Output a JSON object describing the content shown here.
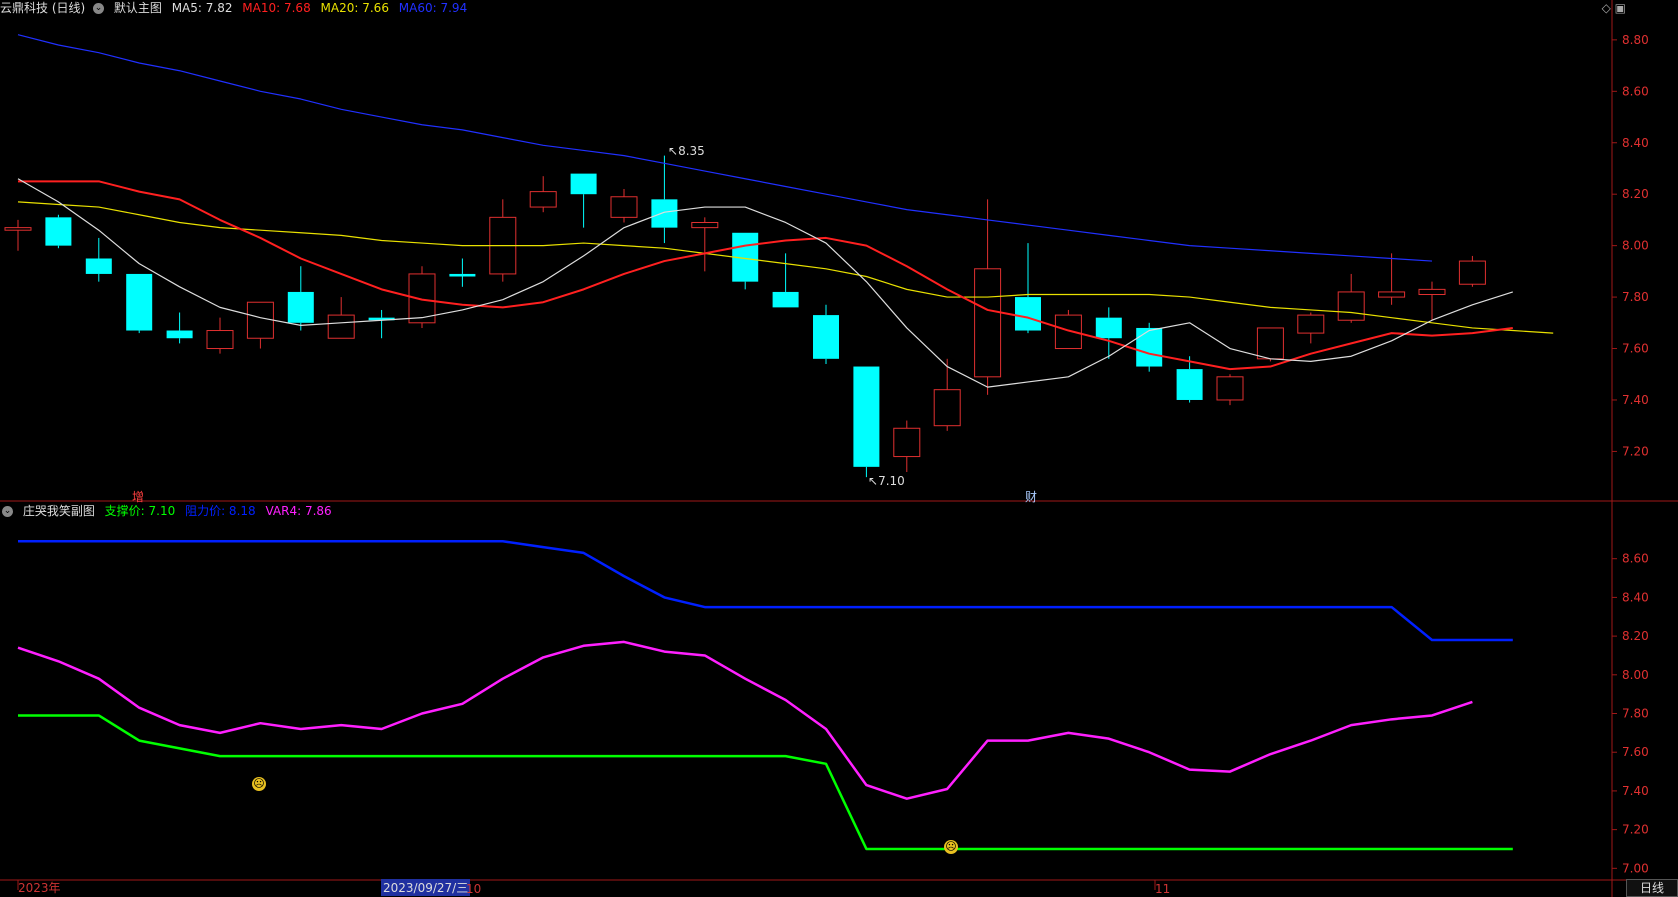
{
  "main_header": {
    "stock_name": "云鼎科技 (日线)",
    "chart_name": "默认主图",
    "ma5_label": "MA5: 7.82",
    "ma10_label": "MA10: 7.68",
    "ma20_label": "MA20: 7.66",
    "ma60_label": "MA60: 7.94"
  },
  "sub_header": {
    "indicator_name": "庄哭我笑副图",
    "support_label": "支撑价: 7.10",
    "resist_label": "阻力价: 8.18",
    "var4_label": "VAR4: 7.86"
  },
  "colors": {
    "up": "#e03030",
    "down": "#00ffff",
    "ma5": "#dddddd",
    "ma10": "#ff2020",
    "ma20": "#e8e000",
    "ma60": "#2030ff",
    "support": "#00ff00",
    "resist": "#0020ff",
    "var4": "#ff20ff"
  },
  "toolbar": {
    "diamond_icon": "diamond-icon",
    "layout_icon": "layout-icon"
  },
  "period_button": "日线",
  "x_axis": {
    "year_label": "2023年",
    "cursor_date": "2023/09/27/三",
    "oct_label": "10",
    "nov_label": "11"
  },
  "markers": {
    "zeng": "增",
    "cai": "财",
    "high_label": "8.35",
    "low_label": "7.10"
  },
  "chart_data": [
    {
      "type": "candlestick",
      "title": "默认主图",
      "ylim": [
        7.05,
        8.85
      ],
      "yticks": [
        "7.20",
        "7.40",
        "7.60",
        "7.80",
        "8.00",
        "8.20",
        "8.40",
        "8.60",
        "8.80"
      ],
      "candles": [
        {
          "o": 8.06,
          "c": 8.07,
          "h": 8.1,
          "l": 7.98
        },
        {
          "o": 8.11,
          "c": 8.0,
          "h": 8.12,
          "l": 7.99
        },
        {
          "o": 7.95,
          "c": 7.89,
          "h": 8.03,
          "l": 7.86
        },
        {
          "o": 7.89,
          "c": 7.67,
          "h": 7.89,
          "l": 7.66
        },
        {
          "o": 7.67,
          "c": 7.64,
          "h": 7.74,
          "l": 7.62
        },
        {
          "o": 7.6,
          "c": 7.67,
          "h": 7.72,
          "l": 7.58
        },
        {
          "o": 7.64,
          "c": 7.78,
          "h": 7.78,
          "l": 7.6
        },
        {
          "o": 7.82,
          "c": 7.7,
          "h": 7.92,
          "l": 7.67
        },
        {
          "o": 7.64,
          "c": 7.73,
          "h": 7.8,
          "l": 7.64
        },
        {
          "o": 7.72,
          "c": 7.71,
          "h": 7.75,
          "l": 7.64
        },
        {
          "o": 7.7,
          "c": 7.89,
          "h": 7.92,
          "l": 7.68
        },
        {
          "o": 7.89,
          "c": 7.88,
          "h": 7.95,
          "l": 7.84
        },
        {
          "o": 7.89,
          "c": 8.11,
          "h": 8.18,
          "l": 7.86
        },
        {
          "o": 8.15,
          "c": 8.21,
          "h": 8.27,
          "l": 8.13
        },
        {
          "o": 8.28,
          "c": 8.2,
          "h": 8.28,
          "l": 8.07
        },
        {
          "o": 8.11,
          "c": 8.19,
          "h": 8.22,
          "l": 8.09
        },
        {
          "o": 8.18,
          "c": 8.07,
          "h": 8.35,
          "l": 8.01
        },
        {
          "o": 8.07,
          "c": 8.09,
          "h": 8.11,
          "l": 7.9
        },
        {
          "o": 8.05,
          "c": 7.86,
          "h": 8.05,
          "l": 7.83
        },
        {
          "o": 7.82,
          "c": 7.76,
          "h": 7.97,
          "l": 7.76
        },
        {
          "o": 7.73,
          "c": 7.56,
          "h": 7.77,
          "l": 7.54
        },
        {
          "o": 7.53,
          "c": 7.14,
          "h": 7.53,
          "l": 7.1
        },
        {
          "o": 7.18,
          "c": 7.29,
          "h": 7.32,
          "l": 7.12
        },
        {
          "o": 7.3,
          "c": 7.44,
          "h": 7.56,
          "l": 7.28
        },
        {
          "o": 7.49,
          "c": 7.91,
          "h": 8.18,
          "l": 7.42
        },
        {
          "o": 7.8,
          "c": 7.67,
          "h": 8.01,
          "l": 7.66
        },
        {
          "o": 7.6,
          "c": 7.73,
          "h": 7.75,
          "l": 7.6
        },
        {
          "o": 7.72,
          "c": 7.64,
          "h": 7.76,
          "l": 7.56
        },
        {
          "o": 7.68,
          "c": 7.53,
          "h": 7.7,
          "l": 7.51
        },
        {
          "o": 7.52,
          "c": 7.4,
          "h": 7.57,
          "l": 7.39
        },
        {
          "o": 7.4,
          "c": 7.49,
          "h": 7.5,
          "l": 7.38
        },
        {
          "o": 7.56,
          "c": 7.68,
          "h": 7.68,
          "l": 7.55
        },
        {
          "o": 7.66,
          "c": 7.73,
          "h": 7.74,
          "l": 7.62
        },
        {
          "o": 7.71,
          "c": 7.82,
          "h": 7.89,
          "l": 7.7
        },
        {
          "o": 7.8,
          "c": 7.82,
          "h": 7.97,
          "l": 7.77
        },
        {
          "o": 7.81,
          "c": 7.83,
          "h": 7.86,
          "l": 7.71
        },
        {
          "o": 7.85,
          "c": 7.94,
          "h": 7.96,
          "l": 7.84
        }
      ],
      "series": [
        {
          "name": "MA5",
          "values": [
            8.26,
            8.17,
            8.06,
            7.93,
            7.84,
            7.76,
            7.72,
            7.69,
            7.7,
            7.71,
            7.72,
            7.75,
            7.79,
            7.86,
            7.96,
            8.07,
            8.13,
            8.15,
            8.15,
            8.09,
            8.01,
            7.86,
            7.68,
            7.53,
            7.45,
            7.47,
            7.49,
            7.57,
            7.67,
            7.7,
            7.6,
            7.56,
            7.55,
            7.57,
            7.63,
            7.71,
            7.77,
            7.82
          ]
        },
        {
          "name": "MA10",
          "values": [
            8.25,
            8.25,
            8.25,
            8.21,
            8.18,
            8.1,
            8.03,
            7.95,
            7.89,
            7.83,
            7.79,
            7.77,
            7.76,
            7.78,
            7.83,
            7.89,
            7.94,
            7.97,
            8.0,
            8.02,
            8.03,
            8.0,
            7.92,
            7.83,
            7.75,
            7.72,
            7.67,
            7.63,
            7.58,
            7.55,
            7.52,
            7.53,
            7.58,
            7.62,
            7.66,
            7.65,
            7.66,
            7.68
          ]
        },
        {
          "name": "MA20",
          "values": [
            8.17,
            8.16,
            8.15,
            8.12,
            8.09,
            8.07,
            8.06,
            8.05,
            8.04,
            8.02,
            8.01,
            8.0,
            8.0,
            8.0,
            8.01,
            8.0,
            7.99,
            7.97,
            7.95,
            7.93,
            7.91,
            7.88,
            7.83,
            7.8,
            7.8,
            7.81,
            7.81,
            7.81,
            7.81,
            7.8,
            7.78,
            7.76,
            7.75,
            7.74,
            7.72,
            7.7,
            7.68,
            7.67,
            7.66
          ]
        },
        {
          "name": "MA60",
          "values": [
            8.82,
            8.78,
            8.75,
            8.71,
            8.68,
            8.64,
            8.6,
            8.57,
            8.53,
            8.5,
            8.47,
            8.45,
            8.42,
            8.39,
            8.37,
            8.35,
            8.32,
            8.29,
            8.26,
            8.23,
            8.2,
            8.17,
            8.14,
            8.12,
            8.1,
            8.08,
            8.06,
            8.04,
            8.02,
            8.0,
            7.99,
            7.98,
            7.97,
            7.96,
            7.95,
            7.94
          ]
        }
      ]
    },
    {
      "type": "line",
      "title": "庄哭我笑副图",
      "ylim": [
        6.95,
        8.8
      ],
      "yticks": [
        "7.00",
        "7.20",
        "7.40",
        "7.60",
        "7.80",
        "8.00",
        "8.20",
        "8.40",
        "8.60"
      ],
      "series": [
        {
          "name": "支撑价",
          "values": [
            7.79,
            7.79,
            7.79,
            7.66,
            7.62,
            7.58,
            7.58,
            7.58,
            7.58,
            7.58,
            7.58,
            7.58,
            7.58,
            7.58,
            7.58,
            7.58,
            7.58,
            7.58,
            7.58,
            7.58,
            7.54,
            7.1,
            7.1,
            7.1,
            7.1,
            7.1,
            7.1,
            7.1,
            7.1,
            7.1,
            7.1,
            7.1,
            7.1,
            7.1,
            7.1,
            7.1,
            7.1,
            7.1
          ]
        },
        {
          "name": "阻力价",
          "values": [
            8.69,
            8.69,
            8.69,
            8.69,
            8.69,
            8.69,
            8.69,
            8.69,
            8.69,
            8.69,
            8.69,
            8.69,
            8.69,
            8.66,
            8.63,
            8.51,
            8.4,
            8.35,
            8.35,
            8.35,
            8.35,
            8.35,
            8.35,
            8.35,
            8.35,
            8.35,
            8.35,
            8.35,
            8.35,
            8.35,
            8.35,
            8.35,
            8.35,
            8.35,
            8.35,
            8.18,
            8.18,
            8.18
          ]
        },
        {
          "name": "VAR4",
          "values": [
            8.14,
            8.07,
            7.98,
            7.83,
            7.74,
            7.7,
            7.75,
            7.72,
            7.74,
            7.72,
            7.8,
            7.85,
            7.98,
            8.09,
            8.15,
            8.17,
            8.12,
            8.1,
            7.98,
            7.87,
            7.72,
            7.43,
            7.36,
            7.41,
            7.66,
            7.66,
            7.7,
            7.67,
            7.6,
            7.51,
            7.5,
            7.59,
            7.66,
            7.74,
            7.77,
            7.79,
            7.86
          ]
        }
      ]
    }
  ]
}
